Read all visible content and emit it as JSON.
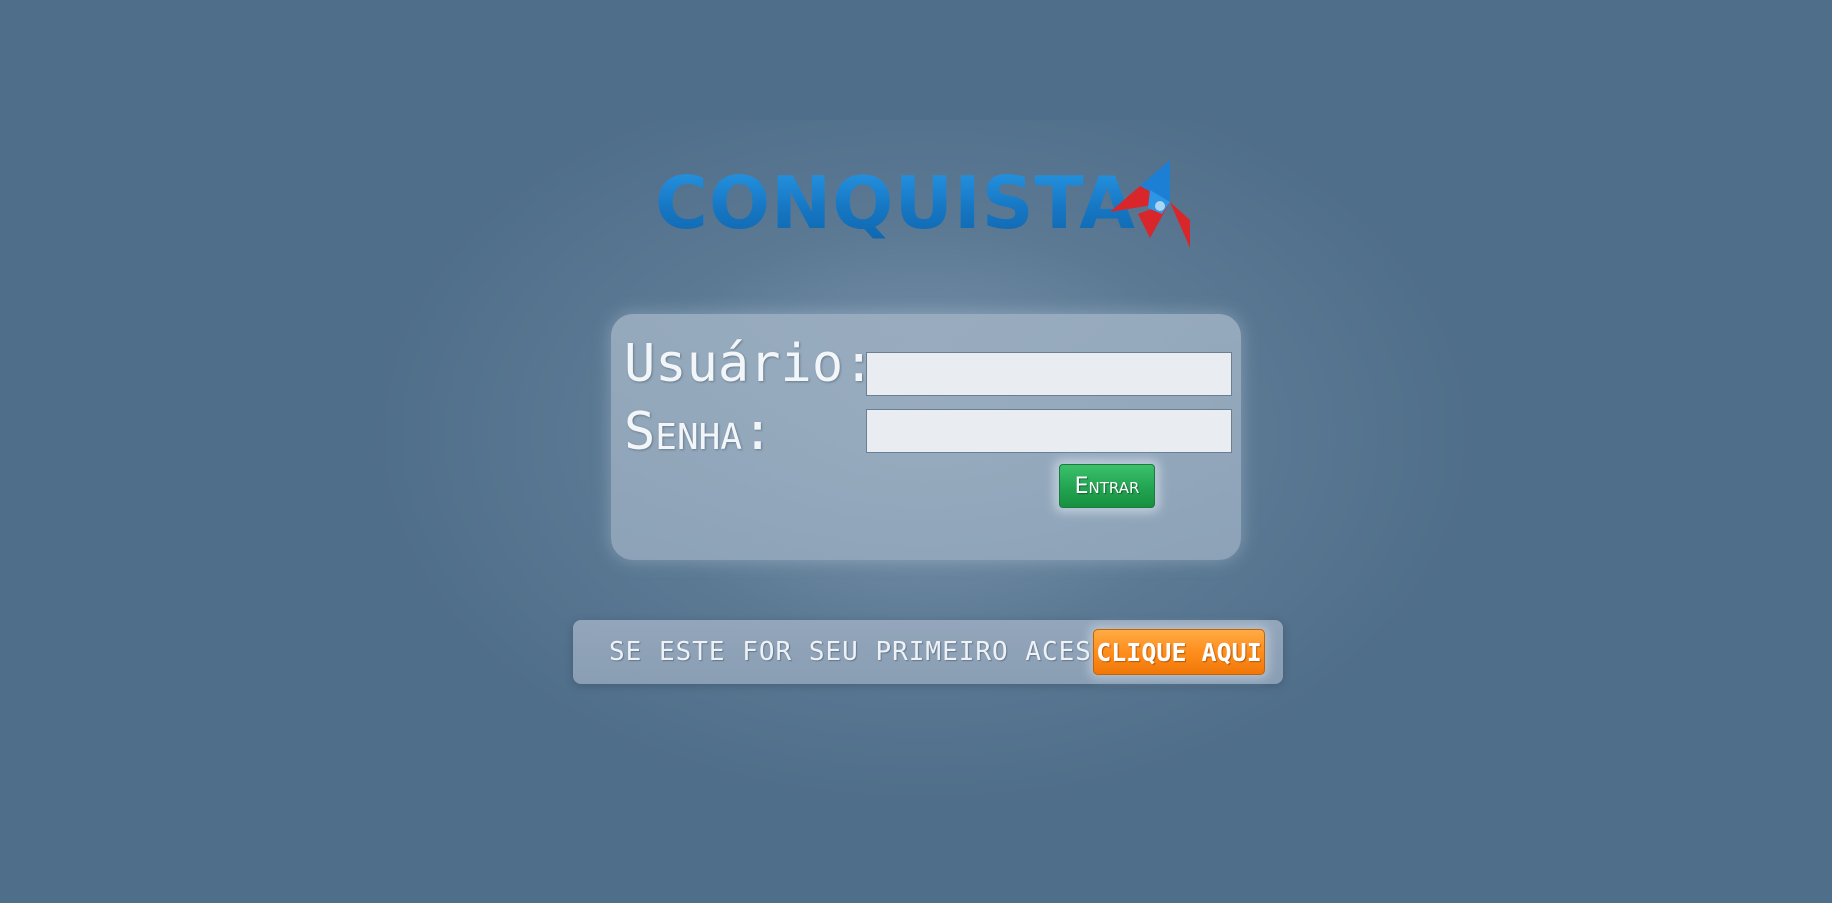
{
  "logo": {
    "text": "CONQUISTA",
    "mark_icon": "conquista-star-icon",
    "colors": {
      "text": "#1e7fd0",
      "mark_red": "#d8262b",
      "mark_blue": "#1c7fd3"
    }
  },
  "login": {
    "user_label": "Usuário:",
    "user_value": "",
    "pass_label": "Senha:",
    "pass_value": "",
    "submit_label": "Entrar"
  },
  "first_access": {
    "text": "SE ESTE FOR SEU PRIMEIRO ACESSO",
    "button_label": "CLIQUE AQUI"
  },
  "colors": {
    "background": "#4f6e89",
    "submit_button": "#22a452",
    "first_access_button": "#ff8e1c"
  }
}
